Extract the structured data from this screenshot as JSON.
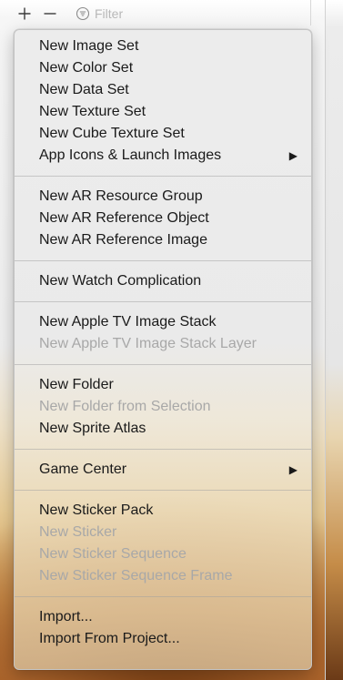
{
  "toolbar": {
    "add_icon": "plus-icon",
    "remove_icon": "minus-icon",
    "filter_icon": "filter-icon",
    "filter_placeholder": "Filter"
  },
  "menu": {
    "group1": [
      {
        "label": "New Image Set"
      },
      {
        "label": "New Color Set"
      },
      {
        "label": "New Data Set"
      },
      {
        "label": "New Texture Set"
      },
      {
        "label": "New Cube Texture Set"
      },
      {
        "label": "App Icons & Launch Images",
        "submenu_arrow": "▶"
      }
    ],
    "group2": [
      {
        "label": "New AR Resource Group"
      },
      {
        "label": "New AR Reference Object"
      },
      {
        "label": "New AR Reference Image"
      }
    ],
    "group3": [
      {
        "label": "New Watch Complication"
      }
    ],
    "group4": [
      {
        "label": "New Apple TV Image Stack"
      },
      {
        "label": "New Apple TV Image Stack Layer",
        "disabled": true
      }
    ],
    "group5": [
      {
        "label": "New Folder"
      },
      {
        "label": "New Folder from Selection",
        "disabled": true
      },
      {
        "label": "New Sprite Atlas"
      }
    ],
    "group6": [
      {
        "label": "Game Center",
        "submenu_arrow": "▶"
      }
    ],
    "group7": [
      {
        "label": "New Sticker Pack"
      },
      {
        "label": "New Sticker",
        "disabled": true
      },
      {
        "label": "New Sticker Sequence",
        "disabled": true
      },
      {
        "label": "New Sticker Sequence Frame",
        "disabled": true
      }
    ],
    "group8": [
      {
        "label": "Import..."
      },
      {
        "label": "Import From Project..."
      }
    ]
  },
  "colors": {
    "text": "#1a1a1a",
    "disabled_text": "#a8a8a8",
    "separator": "#bdbdbd"
  }
}
